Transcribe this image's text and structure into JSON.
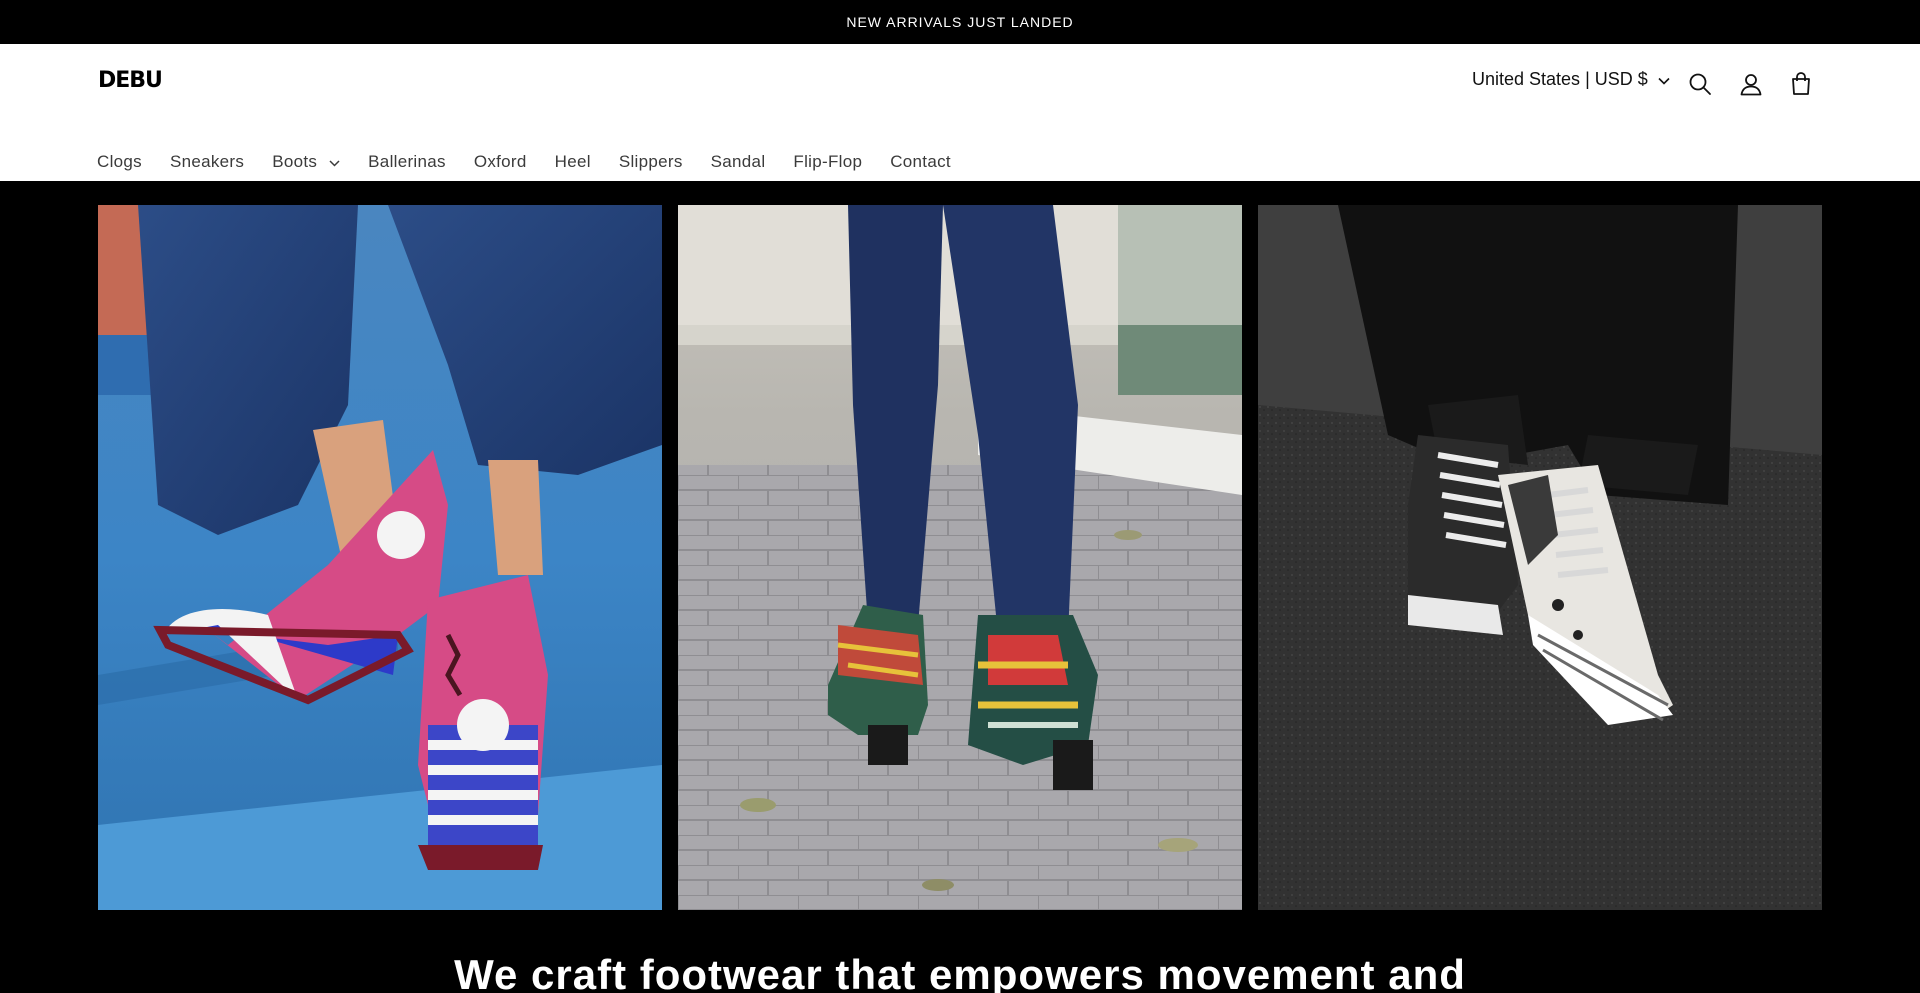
{
  "announcement": {
    "text": "NEW ARRIVALS JUST LANDED"
  },
  "header": {
    "logo": "DEBU",
    "currency": "United States | USD $",
    "icons": [
      "search-icon",
      "account-icon",
      "cart-icon"
    ]
  },
  "nav": {
    "items": [
      {
        "label": "Clogs"
      },
      {
        "label": "Sneakers"
      },
      {
        "label": "Boots",
        "has_dropdown": true
      },
      {
        "label": "Ballerinas"
      },
      {
        "label": "Oxford"
      },
      {
        "label": "Heel"
      },
      {
        "label": "Slippers"
      },
      {
        "label": "Sandal"
      },
      {
        "label": "Flip-Flop"
      },
      {
        "label": "Contact"
      }
    ]
  },
  "hero": {
    "heading": "We craft footwear that empowers movement and",
    "images": [
      "pirate-print-ankle-boots-photo",
      "geometric-print-ankle-boots-photo",
      "white-high-top-sneakers-photo"
    ]
  },
  "colors": {
    "announcement_bg": "#000000",
    "header_bg": "#ffffff",
    "hero_bg": "#000000",
    "text": "#121212"
  }
}
